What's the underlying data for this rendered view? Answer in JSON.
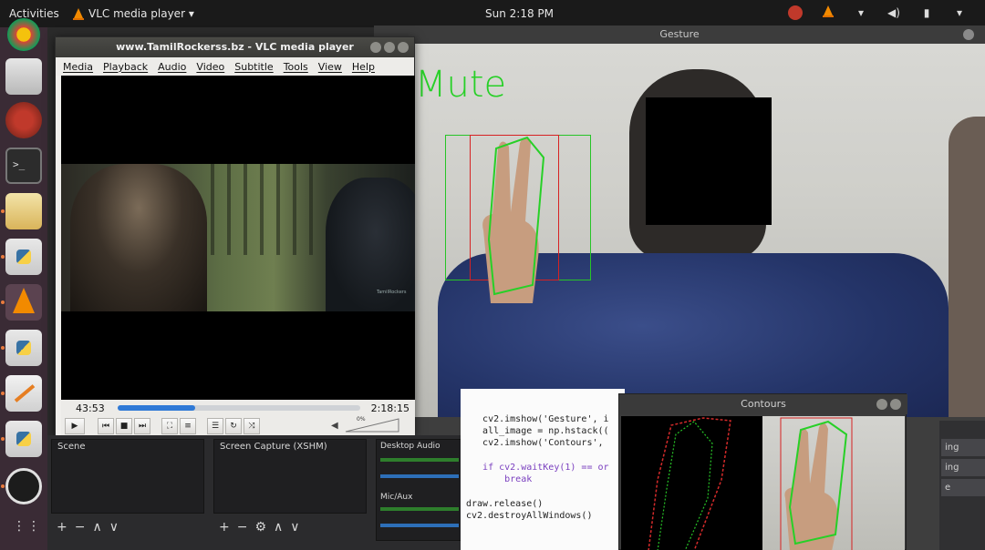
{
  "topbar": {
    "activities": "Activities",
    "app_menu": "VLC media player ▾",
    "clock": "Sun  2:18 PM"
  },
  "gesture": {
    "title": "Gesture",
    "overlay_text": "Mute"
  },
  "vlc": {
    "title": "www.TamilRockerss.bz - VLC media player",
    "menu": [
      "Media",
      "Playback",
      "Audio",
      "Video",
      "Subtitle",
      "Tools",
      "View",
      "Help"
    ],
    "time_elapsed": "43:53",
    "time_total": "2:18:15",
    "progress": 0.32,
    "volume_label": "0%",
    "frame_watermark": "TamilRockers"
  },
  "obs": {
    "scene_label": "Scene",
    "sources_label": "Screen Capture (XSHM)",
    "desktop_audio_label": "Desktop Audio",
    "mic_label": "Mic/Aux"
  },
  "editor": {
    "lines": [
      "",
      "",
      "   cv2.imshow('Gesture', i",
      "   all_image = np.hstack((",
      "   cv2.imshow('Contours',",
      "",
      "   if cv2.waitKey(1) == or",
      "       break",
      "",
      "draw.release()",
      "cv2.destroyAllWindows()"
    ]
  },
  "contours": {
    "title": "Contours"
  },
  "right_strip": {
    "buttons": [
      "ing",
      "ing",
      "e"
    ]
  },
  "colors": {
    "accent_green": "#27d027",
    "vlc_orange": "#f28a00",
    "seek_blue": "#2f79d6",
    "dock_bg": "#3a2b35"
  }
}
